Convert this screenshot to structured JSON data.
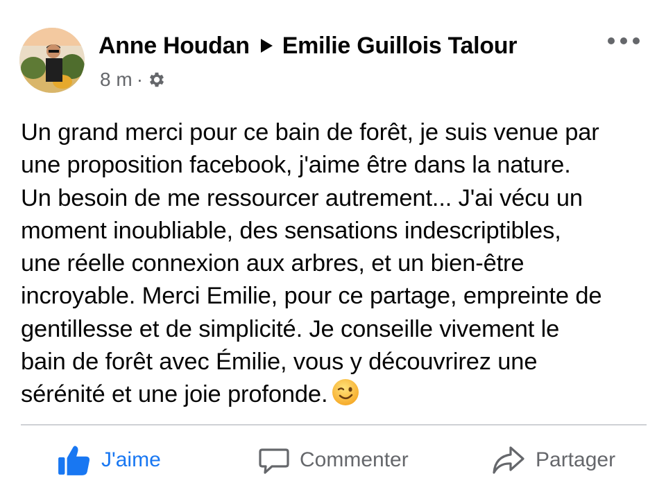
{
  "post": {
    "author": "Anne Houdan",
    "recipient": "Emilie Guillois Talour",
    "time": "8 m",
    "privacy_icon": "gear-icon",
    "body_lines": [
      "Un grand merci pour ce bain de forêt, je suis venue par",
      "une proposition facebook, j'aime être dans la nature.",
      "Un besoin de me ressourcer autrement... J'ai vécu un",
      "moment inoubliable, des sensations indescriptibles,",
      "une réelle connexion aux arbres, et un bien-être",
      "incroyable. Merci Emilie, pour ce partage, empreinte de",
      "gentillesse et de simplicité. Je conseille vivement le",
      "bain de forêt avec Émilie, vous y découvrirez une",
      "sérénité et une joie profonde."
    ],
    "emoji": "winking-face-emoji"
  },
  "actions": {
    "like_label": "J'aime",
    "comment_label": "Commenter",
    "share_label": "Partager"
  },
  "colors": {
    "like_blue": "#1877f2",
    "secondary_gray": "#65676b",
    "divider": "#ced0d4"
  }
}
